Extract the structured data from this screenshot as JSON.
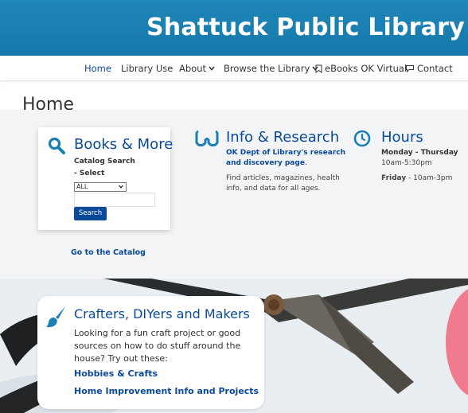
{
  "header": {
    "title": "Shattuck Public Library"
  },
  "nav": {
    "items": [
      {
        "label": "Home"
      },
      {
        "label": "Library Use"
      },
      {
        "label": "About"
      },
      {
        "label": "Browse the Library"
      },
      {
        "label": "eBooks OK Virtual"
      },
      {
        "label": "Contact"
      }
    ],
    "active": "Home"
  },
  "page": {
    "title": "Home"
  },
  "books": {
    "heading": "Books & More",
    "catalog_label_1": "Catalog Search",
    "catalog_label_2": "- Select",
    "select_value": "ALL",
    "search_button": "Search",
    "catalog_link": "Go to the Catalog"
  },
  "info": {
    "heading": "Info & Research",
    "link_line_1": "OK Dept of Library's research",
    "link_line_2": "and discovery page",
    "link_suffix": ".",
    "desc_line_1": "Find articles, magazines, health",
    "desc_line_2": "info, and data for all ages."
  },
  "hours": {
    "heading": "Hours",
    "day_1": "Monday - Thursday",
    "time_1": "10am-5:30pm",
    "day_2": "Friday",
    "time_2": " - 10am-3pm"
  },
  "crafters": {
    "heading": "Crafters, DIYers and Makers",
    "line_1": "Looking for a fun craft project or good",
    "line_2": "sources on how to do stuff around the",
    "line_3": "house? Try out these:",
    "link_1": "Hobbies & Crafts",
    "link_2": "Home Improvement Info and Projects"
  },
  "colors": {
    "brand": "#1a7fb3",
    "link": "#0a4a99"
  }
}
